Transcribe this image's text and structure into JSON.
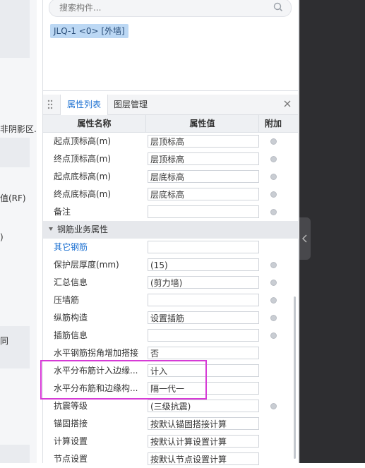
{
  "left_panel": {
    "fragments": [
      "非阴影区.",
      "值(RF)",
      ")",
      "同"
    ]
  },
  "search": {
    "placeholder": "搜索构件..."
  },
  "selected_tag": "JLQ-1 <0> [外墙]",
  "tabs": {
    "active": "属性列表",
    "inactive": "图层管理"
  },
  "table": {
    "headers": {
      "name": "属性名称",
      "value": "属性值",
      "extra": "附加"
    },
    "rows": [
      {
        "name": "起点顶标高(m)",
        "value": "层顶标高",
        "radio": true
      },
      {
        "name": "终点顶标高(m)",
        "value": "层顶标高",
        "radio": true
      },
      {
        "name": "起点底标高(m)",
        "value": "层底标高",
        "radio": true
      },
      {
        "name": "终点底标高(m)",
        "value": "层底标高",
        "radio": true
      },
      {
        "name": "备注",
        "value": "",
        "radio": true
      }
    ],
    "section": "钢筋业务属性",
    "rows2": [
      {
        "name": "其它钢筋",
        "value": "",
        "radio": false,
        "blue": true
      },
      {
        "name": "保护层厚度(mm)",
        "value": "(15)",
        "radio": true
      },
      {
        "name": "汇总信息",
        "value": "(剪力墙)",
        "radio": true
      },
      {
        "name": "压墙筋",
        "value": "",
        "radio": true
      },
      {
        "name": "纵筋构造",
        "value": "设置插筋",
        "radio": true
      },
      {
        "name": "插筋信息",
        "value": "",
        "radio": true
      },
      {
        "name": "水平钢筋拐角增加搭接",
        "value": "否",
        "radio": false
      },
      {
        "name": "水平分布筋计入边缘...",
        "value": "计入",
        "radio": false
      },
      {
        "name": "水平分布筋和边缘构...",
        "value": "隔一代一",
        "radio": false
      },
      {
        "name": "抗震等级",
        "value": "(三级抗震)",
        "radio": true
      },
      {
        "name": "锚固搭接",
        "value": "按默认锚固搭接计算",
        "radio": false
      },
      {
        "name": "计算设置",
        "value": "按默认计算设置计算",
        "radio": false
      },
      {
        "name": "节点设置",
        "value": "按默认节点设置计算",
        "radio": false
      }
    ]
  },
  "colors": {
    "accent": "#1a6fd1",
    "highlight": "#d63bd6",
    "tag_bg": "#bcd8f4"
  }
}
